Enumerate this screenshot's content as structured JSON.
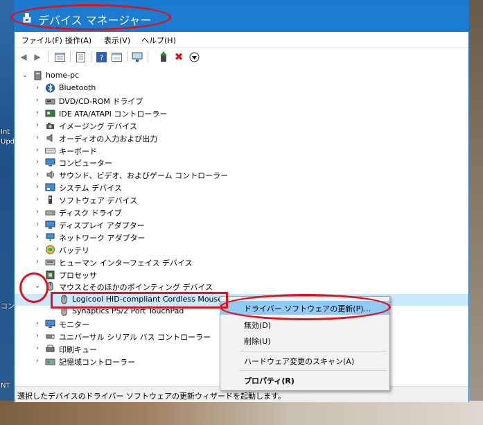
{
  "window": {
    "title": "デバイス マネージャー",
    "menu": [
      "ファイル(F)",
      "操作(A)",
      "表示(V)",
      "ヘルプ(H)"
    ]
  },
  "tree": {
    "root": "home-pc",
    "categories": [
      "Bluetooth",
      "DVD/CD-ROM ドライブ",
      "IDE ATA/ATAPI コントローラー",
      "イメージング デバイス",
      "オーディオの入力および出力",
      "キーボード",
      "コンピューター",
      "サウンド、ビデオ、およびゲーム コントローラー",
      "システム デバイス",
      "ソフトウェア デバイス",
      "ディスク ドライブ",
      "ディスプレイ アダプター",
      "ネットワーク アダプター",
      "バッテリ",
      "ヒューマン インターフェイス デバイス",
      "プロセッサ",
      "マウスとそのほかのポインティング デバイス"
    ],
    "mouse_children": [
      "Logicool HID-compliant Cordless Mouse",
      "Synaptics PS/2 Port TouchPad"
    ],
    "after": [
      "モニター",
      "ユニバーサル シリアル バス コントローラー",
      "印刷キュー",
      "記憶域コントローラー"
    ]
  },
  "context_menu": {
    "update": "ドライバー ソフトウェアの更新(P)...",
    "disable": "無効(D)",
    "uninstall": "削除(U)",
    "scan": "ハードウェア変更のスキャン(A)",
    "properties": "プロパティ(R)"
  },
  "status": "選択したデバイスのドライバー ソフトウェアの更新ウィザードを起動します。",
  "desktop": {
    "left_labels": [
      "Int",
      "Upd",
      "コン",
      "NT"
    ]
  },
  "colors": {
    "titlebar": "#1a7bd1",
    "selection": "#cce8ff",
    "annotation": "#e0121a"
  }
}
